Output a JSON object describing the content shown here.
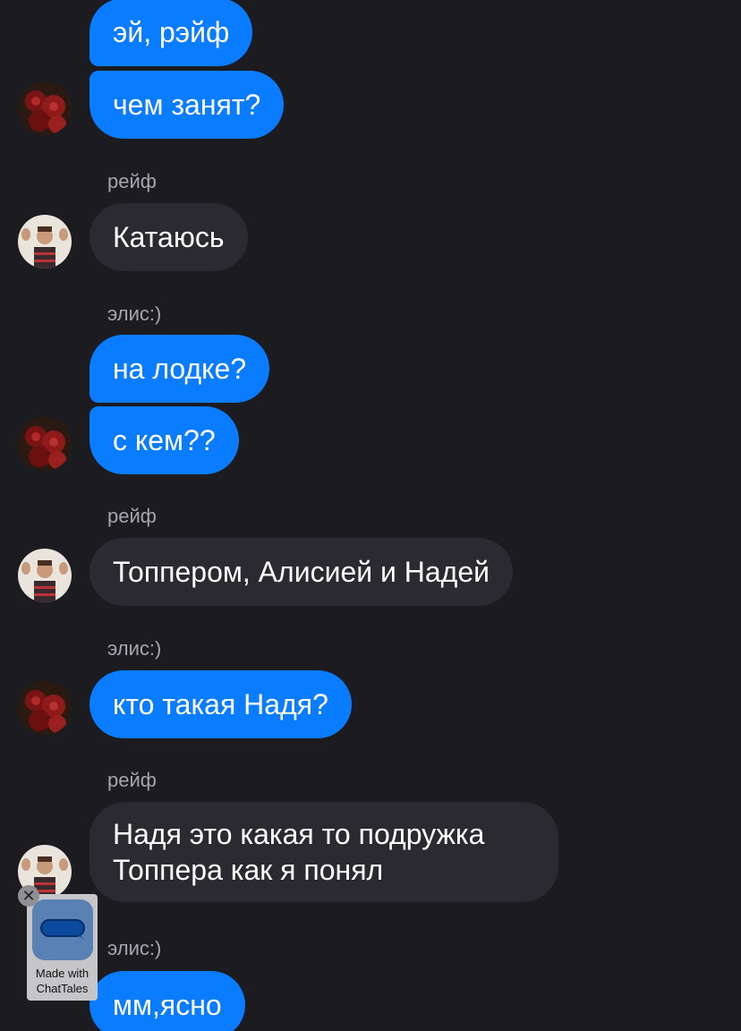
{
  "chat": {
    "names": {
      "boy": "рейф",
      "girl": "элис:)"
    },
    "messages": [
      {
        "text": "эй, рэйф"
      },
      {
        "text": "чем занят?"
      },
      {
        "text": "Катаюсь"
      },
      {
        "text": "на лодке?"
      },
      {
        "text": "с кем??"
      },
      {
        "text": "Топпером, Алисией и Надей"
      },
      {
        "text": "кто такая Надя?"
      },
      {
        "text": "Надя это какая то подружка Топпера как я понял"
      },
      {
        "text": "мм,ясно"
      }
    ]
  },
  "avatars": {
    "girl": "roses-avatar",
    "boy": "person-waving-avatar"
  },
  "watermark": {
    "line1": "Made with",
    "line2": "ChatTales",
    "close_icon": "close-icon"
  },
  "colors": {
    "background": "#1c1b20",
    "outgoing": "#0a7cff",
    "incoming": "#2b2a30",
    "sender_name": "#a6a5ab"
  }
}
